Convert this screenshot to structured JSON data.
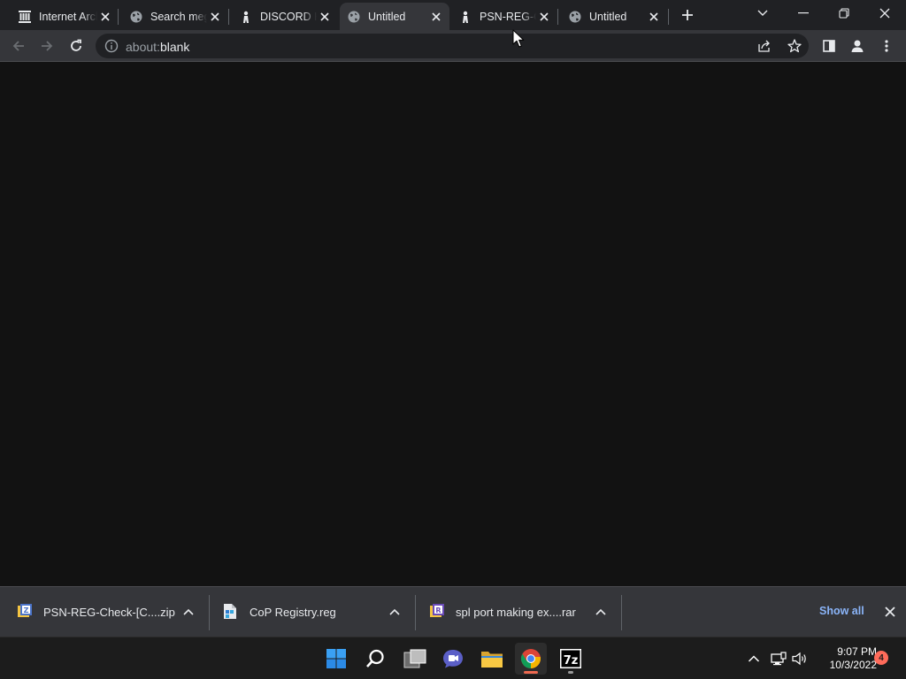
{
  "browser": {
    "tabs": [
      {
        "title": "Internet Archive",
        "icon": "archive-icon",
        "active": false
      },
      {
        "title": "Search mega",
        "icon": "globe-icon",
        "active": false
      },
      {
        "title": "DISCORD H",
        "icon": "person-icon",
        "active": false
      },
      {
        "title": "Untitled",
        "icon": "globe-icon",
        "active": true
      },
      {
        "title": "PSN-REG-C",
        "icon": "person-icon",
        "active": false
      },
      {
        "title": "Untitled",
        "icon": "globe-icon",
        "active": false
      }
    ],
    "address": {
      "scheme": "about:",
      "path": "blank"
    }
  },
  "downloads": [
    {
      "filename": "PSN-REG-Check-[C....zip",
      "icon": "zip-file-icon"
    },
    {
      "filename": "CoP Registry.reg",
      "icon": "registry-file-icon"
    },
    {
      "filename": "spl port making ex....rar",
      "icon": "rar-file-icon"
    }
  ],
  "shelf": {
    "show_all": "Show all"
  },
  "taskbar": {
    "time": "9:07 PM",
    "date": "10/3/2022",
    "notification_count": "4"
  },
  "colors": {
    "tab_strip": "#202124",
    "toolbar": "#35363a",
    "page_background": "#121212",
    "link": "#8ab4f8",
    "notification": "#ff6b5a"
  }
}
